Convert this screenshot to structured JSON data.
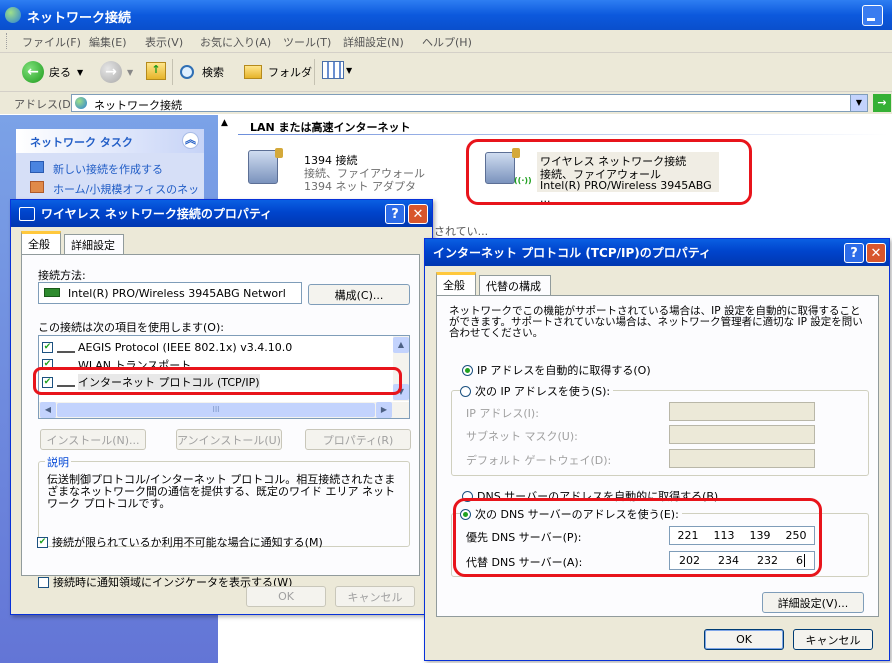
{
  "explorer": {
    "title": "ネットワーク接続",
    "menu": [
      "ファイル(F)",
      "編集(E)",
      "表示(V)",
      "お気に入り(A)",
      "ツール(T)",
      "詳細設定(N)",
      "ヘルプ(H)"
    ],
    "toolbar": {
      "back": "戻る",
      "search": "検索",
      "folders": "フォルダ"
    },
    "address_label": "アドレス(D)",
    "address_value": "ネットワーク接続",
    "task_title": "ネットワーク タスク",
    "tasks": [
      "新しい接続を作成する",
      "ホーム/小規模オフィスのネッ"
    ],
    "section_header": "LAN または高速インターネット",
    "conn1": {
      "name": "1394 接続",
      "status": "接続、ファイアウォール",
      "device": "1394 ネット アダプタ"
    },
    "conn2": {
      "name": "ワイヤレス ネットワーク接続",
      "status": "接続、ファイアウォール",
      "device": "Intel(R) PRO/Wireless 3945ABG ..."
    },
    "partial_text": "されてい..."
  },
  "wlprops": {
    "title": "ワイヤレス ネットワーク接続のプロパティ",
    "tabs": [
      "全般",
      "詳細設定"
    ],
    "connect_using_label": "接続方法:",
    "adapter": "Intel(R) PRO/Wireless 3945ABG Networl",
    "configure_btn": "構成(C)...",
    "items_label": "この接続は次の項目を使用します(O):",
    "items": [
      "AEGIS Protocol (IEEE 802.1x) v3.4.10.0",
      "WLAN トランスポート",
      "インターネット プロトコル (TCP/IP)"
    ],
    "scroll_mark": "III",
    "install_btn": "インストール(N)...",
    "uninstall_btn": "アンインストール(U)",
    "props_btn": "プロパティ(R)",
    "desc_label": "説明",
    "desc_text": "伝送制御プロトコル/インターネット プロトコル。相互接続されたさまざまなネットワーク間の通信を提供する、既定のワイド エリア ネットワーク プロトコルです。",
    "chk1": "接続時に通知領域にインジケータを表示する(W)",
    "chk2": "接続が限られているか利用不可能な場合に通知する(M)",
    "ok": "OK",
    "cancel": "キャンセル"
  },
  "tcpip": {
    "title": "インターネット プロトコル (TCP/IP)のプロパティ",
    "tabs": [
      "全般",
      "代替の構成"
    ],
    "intro": "ネットワークでこの機能がサポートされている場合は、IP 設定を自動的に取得することができます。サポートされていない場合は、ネットワーク管理者に適切な IP 設定を問い合わせてください。",
    "auto_ip": "IP アドレスを自動的に取得する(O)",
    "manual_ip": "次の IP アドレスを使う(S):",
    "ip_label": "IP アドレス(I):",
    "mask_label": "サブネット マスク(U):",
    "gw_label": "デフォルト ゲートウェイ(D):",
    "auto_dns": "DNS サーバーのアドレスを自動的に取得する(B)",
    "manual_dns": "次の DNS サーバーのアドレスを使う(E):",
    "pref_dns_label": "優先 DNS サーバー(P):",
    "pref_dns": [
      "221",
      "113",
      "139",
      "250"
    ],
    "alt_dns_label": "代替 DNS サーバー(A):",
    "alt_dns": [
      "202",
      "234",
      "232",
      "6"
    ],
    "advanced_btn": "詳細設定(V)...",
    "ok": "OK",
    "cancel": "キャンセル"
  }
}
